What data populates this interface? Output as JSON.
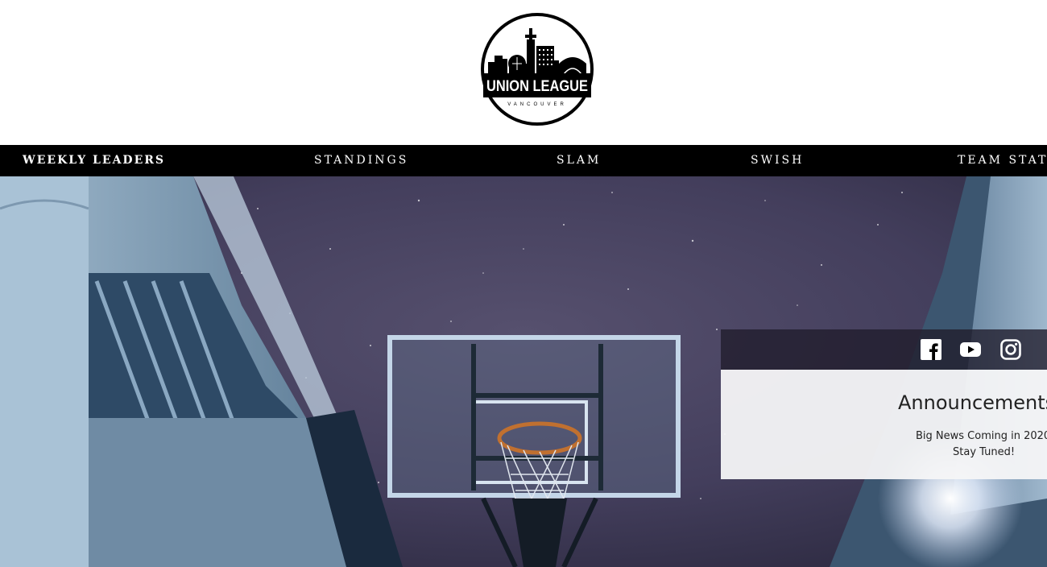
{
  "logo": {
    "text": "UNION LEAGUE",
    "subtext": "VANCOUVER"
  },
  "nav": {
    "items": [
      {
        "label": "WEEKLY LEADERS"
      },
      {
        "label": "STANDINGS"
      },
      {
        "label": "SLAM"
      },
      {
        "label": "SWISH"
      },
      {
        "label": "TEAM STATS"
      }
    ]
  },
  "social": {
    "icons": [
      "facebook-icon",
      "youtube-icon",
      "instagram-icon"
    ]
  },
  "announcements": {
    "title": "Announcements",
    "line1": "Big News Coming in 2020",
    "line2": "Stay Tuned!"
  },
  "colors": {
    "nav_bg": "#000000",
    "nav_text": "#ffffff",
    "hero_sky": "#4a4664",
    "panel_bg": "#f5f5f7"
  }
}
